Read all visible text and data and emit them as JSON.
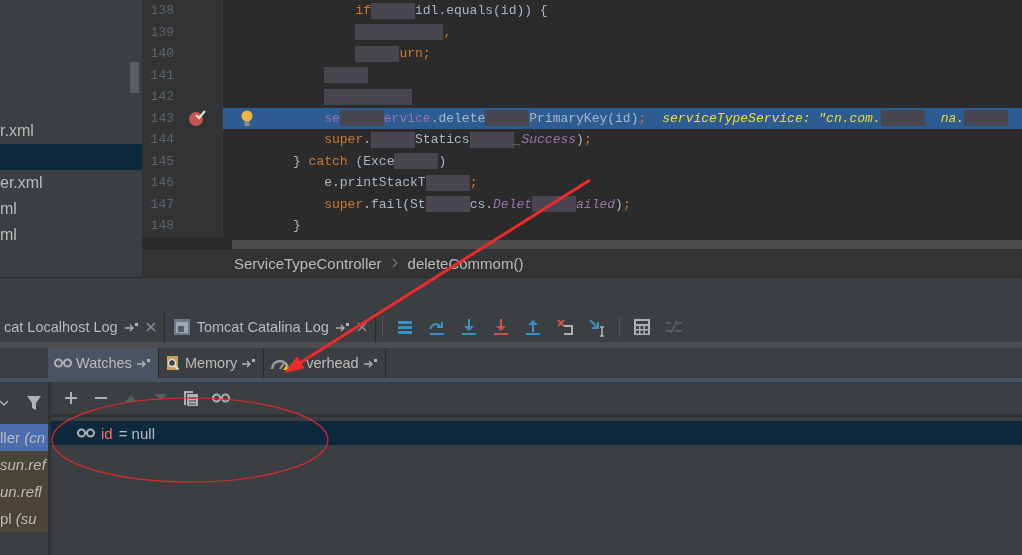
{
  "project_tree": {
    "items": [
      {
        "label": "r.xml",
        "selected": false
      },
      {
        "selected": true
      },
      {
        "label": "er.xml",
        "selected": false
      },
      {
        "label": "ml",
        "selected": false
      },
      {
        "label": "ml",
        "selected": false
      }
    ]
  },
  "editor": {
    "lines": [
      {
        "number": "138",
        "breakpoint": false,
        "bulb": false,
        "current": false,
        "tokens": [
          {
            "kind": "indent"
          },
          {
            "kind": "indent"
          },
          {
            "kind": "keyword",
            "text": "if"
          },
          {
            "kind": "redacted"
          },
          {
            "kind": "plain",
            "text": "idl.equals(id)) {"
          }
        ]
      },
      {
        "number": "139",
        "breakpoint": false,
        "bulb": false,
        "current": false,
        "tokens": [
          {
            "kind": "indent"
          },
          {
            "kind": "indent"
          },
          {
            "kind": "redacted"
          },
          {
            "kind": "redacted"
          },
          {
            "kind": "keyword",
            "text": ","
          }
        ]
      },
      {
        "number": "140",
        "breakpoint": false,
        "bulb": false,
        "current": false,
        "tokens": [
          {
            "kind": "indent"
          },
          {
            "kind": "indent"
          },
          {
            "kind": "redacted"
          },
          {
            "kind": "keyword",
            "text": "urn;"
          }
        ]
      },
      {
        "number": "141",
        "breakpoint": false,
        "bulb": false,
        "current": false,
        "tokens": [
          {
            "kind": "indent"
          },
          {
            "kind": "redacted"
          }
        ]
      },
      {
        "number": "142",
        "breakpoint": false,
        "bulb": false,
        "current": false,
        "tokens": [
          {
            "kind": "indent"
          },
          {
            "kind": "redacted"
          },
          {
            "kind": "redacted"
          }
        ]
      },
      {
        "number": "143",
        "breakpoint": true,
        "bulb": true,
        "current": true,
        "tokens": [
          {
            "kind": "indent"
          },
          {
            "kind": "field",
            "text": "se"
          },
          {
            "kind": "redacted"
          },
          {
            "kind": "field",
            "text": "ervice"
          },
          {
            "kind": "plain",
            "text": ".delete"
          },
          {
            "kind": "redacted"
          },
          {
            "kind": "plain",
            "text": "PrimaryKey(id)"
          },
          {
            "kind": "keyword",
            "text": ";"
          },
          {
            "kind": "inline",
            "text": "serviceTypeService: \"cn.com."
          },
          {
            "kind": "redacted"
          },
          {
            "kind": "inline",
            "text": "na."
          },
          {
            "kind": "redacted"
          }
        ]
      },
      {
        "number": "144",
        "breakpoint": false,
        "bulb": false,
        "current": false,
        "tokens": [
          {
            "kind": "indent"
          },
          {
            "kind": "keyword",
            "text": "super"
          },
          {
            "kind": "plain",
            "text": "."
          },
          {
            "kind": "redacted"
          },
          {
            "kind": "plain",
            "text": "Statics"
          },
          {
            "kind": "redacted"
          },
          {
            "kind": "static",
            "text": "_Success"
          },
          {
            "kind": "plain",
            "text": ")"
          },
          {
            "kind": "keyword",
            "text": ";"
          }
        ]
      },
      {
        "number": "145",
        "breakpoint": false,
        "bulb": false,
        "current": false,
        "tokens": [
          {
            "kind": "plain",
            "text": "}"
          },
          {
            "kind": "gap"
          },
          {
            "kind": "keyword",
            "text": "catch"
          },
          {
            "kind": "gap"
          },
          {
            "kind": "plain",
            "text": "(Exce"
          },
          {
            "kind": "redacted"
          },
          {
            "kind": "plain",
            "text": ")"
          }
        ]
      },
      {
        "number": "146",
        "breakpoint": false,
        "bulb": false,
        "current": false,
        "tokens": [
          {
            "kind": "indent"
          },
          {
            "kind": "plain",
            "text": "e.printStackT"
          },
          {
            "kind": "redacted"
          },
          {
            "kind": "keyword",
            "text": ";"
          }
        ]
      },
      {
        "number": "147",
        "breakpoint": false,
        "bulb": false,
        "current": false,
        "tokens": [
          {
            "kind": "indent"
          },
          {
            "kind": "keyword",
            "text": "super"
          },
          {
            "kind": "plain",
            "text": ".fail(St"
          },
          {
            "kind": "redacted"
          },
          {
            "kind": "plain",
            "text": "cs."
          },
          {
            "kind": "static",
            "text": "Delet"
          },
          {
            "kind": "redacted"
          },
          {
            "kind": "static",
            "text": "ailed"
          },
          {
            "kind": "plain",
            "text": ")"
          },
          {
            "kind": "keyword",
            "text": ";"
          }
        ]
      },
      {
        "number": "148",
        "breakpoint": false,
        "bulb": false,
        "current": false,
        "tokens": [
          {
            "kind": "plain",
            "text": "}"
          }
        ]
      }
    ]
  },
  "breadcrumbs": [
    "ServiceTypeController",
    "deleteCommom()"
  ],
  "tool_tabs": [
    {
      "label": "cat Localhost Log",
      "kind": "plain"
    },
    {
      "label": "Tomcat Catalina Log",
      "kind": "window"
    }
  ],
  "debug_toolbar": [
    {
      "kind": "frames",
      "disabled": false
    },
    {
      "kind": "step-over",
      "disabled": false
    },
    {
      "kind": "step-into",
      "disabled": false
    },
    {
      "kind": "force-step-into",
      "disabled": false
    },
    {
      "kind": "step-out",
      "disabled": false
    },
    {
      "kind": "drop-frame",
      "disabled": false
    },
    {
      "kind": "run-to-cursor",
      "disabled": false
    },
    {
      "kind": "calculator",
      "disabled": false
    },
    {
      "kind": "trace",
      "disabled": true
    }
  ],
  "sub_tabs": [
    {
      "label": "Watches",
      "kind": "watches",
      "selected": true
    },
    {
      "label": "Memory",
      "kind": "memory",
      "selected": false
    },
    {
      "label": "verhead",
      "kind": "overhead",
      "selected": false
    }
  ],
  "frames": {
    "items": [
      {
        "text": "ller *(cn*",
        "selected": true
      },
      {
        "text": "*sun.ref*",
        "selected": false
      },
      {
        "text": "*un.refl*",
        "selected": false
      },
      {
        "text": "pl *(su*",
        "selected": false
      }
    ]
  },
  "watches_toolbar": [
    {
      "kind": "add",
      "disabled": false
    },
    {
      "kind": "remove",
      "disabled": false
    },
    {
      "kind": "up",
      "disabled": true
    },
    {
      "kind": "down",
      "disabled": true
    },
    {
      "kind": "copy",
      "disabled": false
    },
    {
      "kind": "glasses",
      "disabled": false
    }
  ],
  "watches": [
    {
      "name": "id",
      "value": "= null",
      "selected": true
    }
  ],
  "annotations": [
    {
      "kind": "arrow"
    },
    {
      "kind": "ellipse"
    }
  ]
}
